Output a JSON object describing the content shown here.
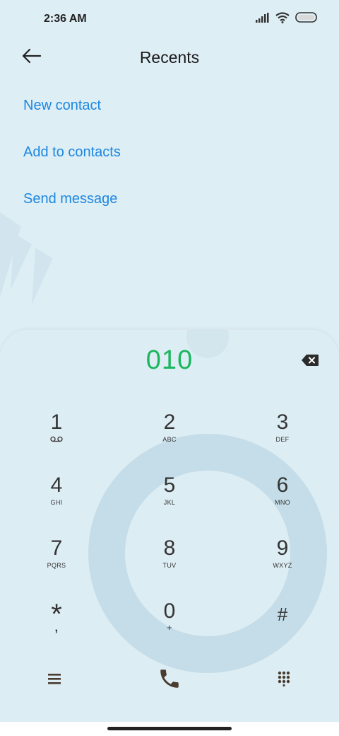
{
  "status_bar": {
    "time": "2:36 AM",
    "icons": [
      "signal-icon",
      "wifi-icon",
      "battery-icon"
    ]
  },
  "header": {
    "title": "Recents",
    "back_icon": "arrow-left-icon"
  },
  "actions": [
    {
      "label": "New contact"
    },
    {
      "label": "Add to contacts"
    },
    {
      "label": "Send message"
    }
  ],
  "dialer": {
    "number": "010",
    "backspace_icon": "backspace-icon",
    "keys": [
      {
        "digit": "1",
        "letters": "",
        "sub_icon": "voicemail-icon"
      },
      {
        "digit": "2",
        "letters": "ABC"
      },
      {
        "digit": "3",
        "letters": "DEF"
      },
      {
        "digit": "4",
        "letters": "GHI"
      },
      {
        "digit": "5",
        "letters": "JKL"
      },
      {
        "digit": "6",
        "letters": "MNO"
      },
      {
        "digit": "7",
        "letters": "PQRS"
      },
      {
        "digit": "8",
        "letters": "TUV"
      },
      {
        "digit": "9",
        "letters": "WXYZ"
      },
      {
        "digit": "*",
        "letters": ","
      },
      {
        "digit": "0",
        "letters": "+"
      },
      {
        "digit": "#",
        "letters": ""
      }
    ]
  },
  "bottom_bar": {
    "icons": [
      "menu-icon",
      "phone-call-icon",
      "dialpad-icon"
    ]
  },
  "colors": {
    "background": "#deeef5",
    "accent_link": "#1d87e0",
    "dialed_number": "#1ab55c",
    "call_icon": "#4a3c2f"
  }
}
